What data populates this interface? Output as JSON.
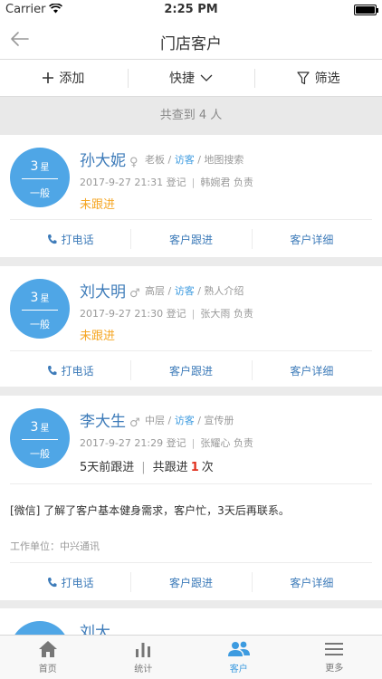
{
  "status_bar": {
    "carrier": "Carrier",
    "time": "2:25 PM"
  },
  "nav": {
    "title": "门店客户"
  },
  "toolbar": {
    "add": "添加",
    "quick": "快捷",
    "filter": "筛选"
  },
  "result_count": "共查到 4 人",
  "actions": {
    "call": "打电话",
    "follow": "客户跟进",
    "detail": "客户详细"
  },
  "customers": [
    {
      "stars": "3",
      "star_unit": "星",
      "level": "一般",
      "name": "孙大妮",
      "sex": "♀",
      "role": "老板",
      "visit": "访客",
      "source": "地图搜索",
      "registered": "2017-9-27 21:31 登记",
      "owner": "韩婉君 负责",
      "status": "未跟进"
    },
    {
      "stars": "3",
      "star_unit": "星",
      "level": "一般",
      "name": "刘大明",
      "sex": "♂",
      "role": "高层",
      "visit": "访客",
      "source": "熟人介绍",
      "registered": "2017-9-27 21:30 登记",
      "owner": "张大雨 负责",
      "status": "未跟进"
    },
    {
      "stars": "3",
      "star_unit": "星",
      "level": "一般",
      "name": "李大生",
      "sex": "♂",
      "role": "中层",
      "visit": "访客",
      "source": "宣传册",
      "registered": "2017-9-27 21:29 登记",
      "owner": "张耀心 负责",
      "last_follow": "5天前跟进",
      "follow_prefix": "共跟进",
      "follow_count": "1",
      "follow_suffix": "次",
      "note": "[微信] 了解了客户基本健身需求，客户忙，3天后再联系。",
      "work_unit": "工作单位：中兴通讯"
    },
    {
      "name": "刘大"
    }
  ],
  "tabbar": {
    "home": "首页",
    "stats": "统计",
    "customer": "客户",
    "more": "更多"
  },
  "colors": {
    "accent": "#3d9be0",
    "badge": "#4fa6e6",
    "pending": "#f5a623",
    "count_highlight": "#e0301e"
  }
}
